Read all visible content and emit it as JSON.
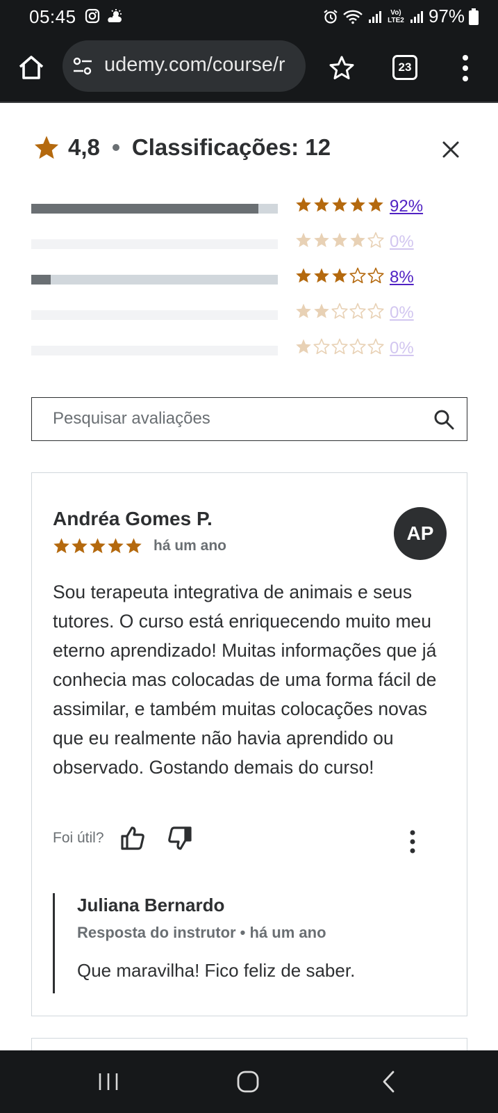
{
  "status_bar": {
    "time": "05:45",
    "network_label": "Vo) LTE2",
    "battery": "97%"
  },
  "browser": {
    "url": "udemy.com/course/r",
    "tab_count": "23"
  },
  "ratings": {
    "average": "4,8",
    "count_label": "Classificações: 12",
    "star_color": "#b4690e",
    "distribution": [
      {
        "stars": 5,
        "fraction": 0.92,
        "percent_label": "92%",
        "active": true
      },
      {
        "stars": 4,
        "fraction": 0.0,
        "percent_label": "0%",
        "active": false
      },
      {
        "stars": 3,
        "fraction": 0.08,
        "percent_label": "8%",
        "active": true
      },
      {
        "stars": 2,
        "fraction": 0.0,
        "percent_label": "0%",
        "active": false
      },
      {
        "stars": 1,
        "fraction": 0.0,
        "percent_label": "0%",
        "active": false
      }
    ]
  },
  "search": {
    "placeholder": "Pesquisar avaliações"
  },
  "review": {
    "name": "Andréa Gomes P.",
    "rating": 5,
    "time": "há um ano",
    "initials": "AP",
    "body": "Sou terapeuta integrativa de animais e seus tutores. O curso está enriquecendo muito meu eterno aprendizado! Muitas informações que já conhecia mas colocadas de uma forma fácil de assimilar, e também muitas colocações novas que eu realmente não havia aprendido ou observado. Gostando demais do curso!",
    "helpful_label": "Foi útil?",
    "reply": {
      "name": "Juliana Bernardo",
      "meta": "Resposta do instrutor • há um ano",
      "body": "Que maravilha! Fico feliz de saber."
    }
  },
  "icons": {
    "home": "home-icon",
    "url_settings": "tune-icon",
    "bookmark": "star-outline-icon",
    "tabs": "tabs-icon",
    "menu": "more-vert-icon",
    "close": "close-icon",
    "search": "search-icon",
    "thumbs_up": "thumbs-up-icon",
    "thumbs_down": "thumbs-down-icon"
  }
}
